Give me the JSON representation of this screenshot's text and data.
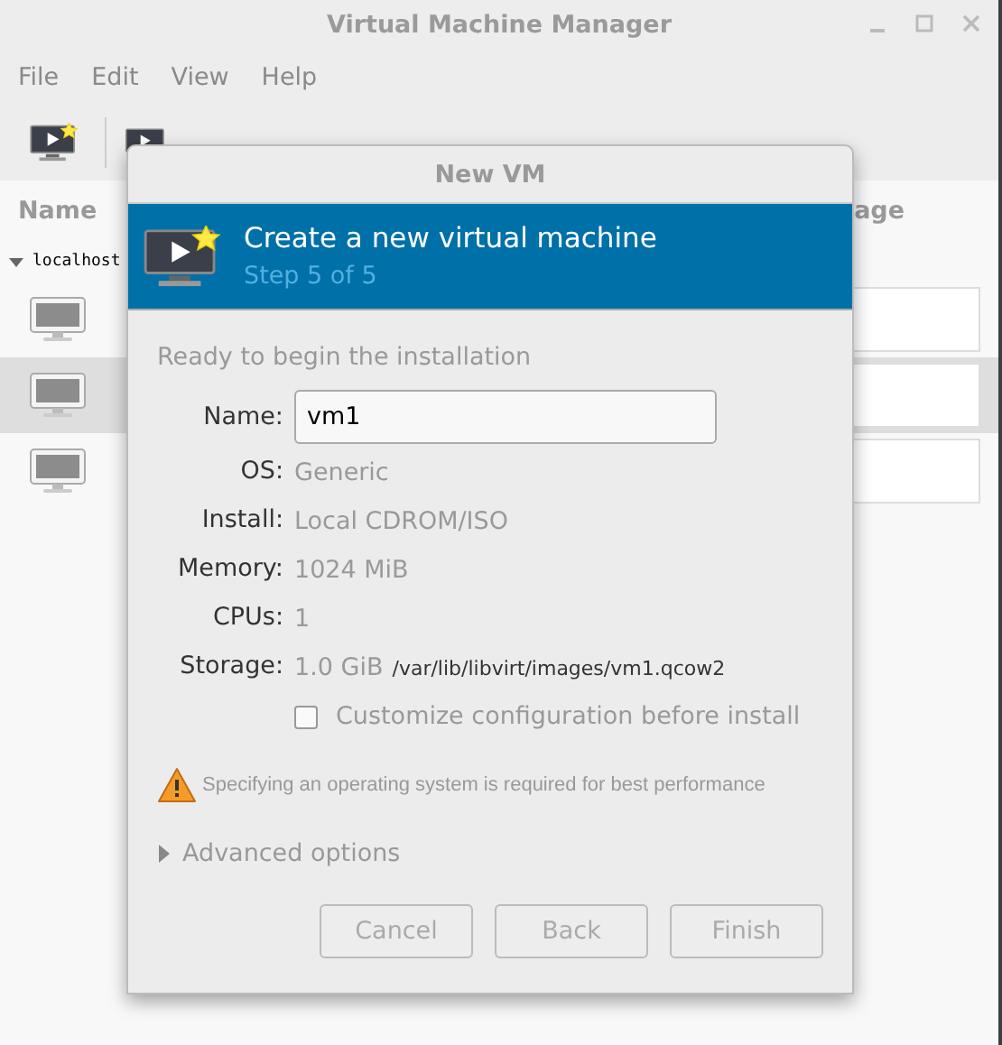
{
  "window": {
    "title": "Virtual Machine Manager"
  },
  "menu": [
    "File",
    "Edit",
    "View",
    "Help"
  ],
  "list": {
    "columns": [
      "Name",
      "age"
    ],
    "group": {
      "label": "localhost",
      "expanded": true
    },
    "rows": [
      {
        "selected": false
      },
      {
        "selected": true
      },
      {
        "selected": false
      }
    ]
  },
  "dialog": {
    "title": "New VM",
    "header": {
      "title": "Create a new virtual machine",
      "step": "Step 5 of 5"
    },
    "intro": "Ready to begin the installation",
    "name": {
      "label": "Name:",
      "value": "vm1"
    },
    "details": [
      {
        "label": "OS:",
        "value": "Generic"
      },
      {
        "label": "Install:",
        "value": "Local CDROM/ISO"
      },
      {
        "label": "Memory:",
        "value": "1024 MiB"
      },
      {
        "label": "CPUs:",
        "value": "1"
      },
      {
        "label": "Storage:",
        "value": "1.0 GiB",
        "extra": "/var/lib/libvirt/images/vm1.qcow2"
      }
    ],
    "customize": {
      "label": "Customize configuration before install",
      "checked": false
    },
    "warning": "Specifying an operating system is required for best performance",
    "advanced": {
      "label": "Advanced options",
      "expanded": false
    },
    "buttons": [
      {
        "label": "Cancel",
        "disabled": true
      },
      {
        "label": "Back",
        "disabled": true
      },
      {
        "label": "Finish",
        "disabled": true
      }
    ]
  }
}
